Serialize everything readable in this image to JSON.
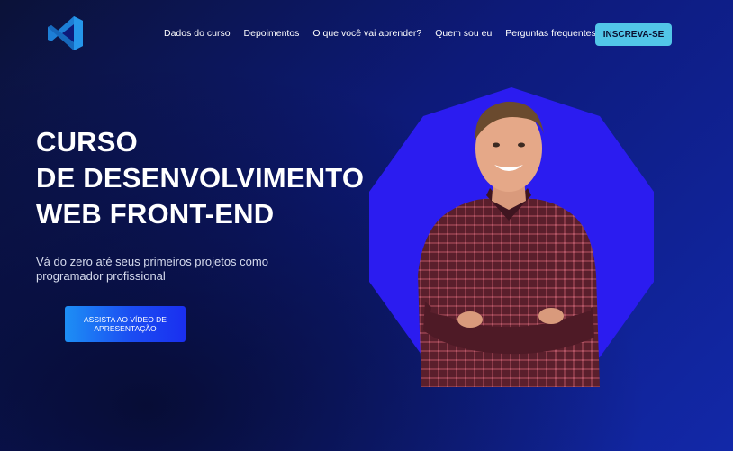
{
  "header": {
    "logo_icon": "vscode-logo-icon",
    "nav": [
      {
        "label": "Dados do curso"
      },
      {
        "label": "Depoimentos"
      },
      {
        "label": "O que você vai aprender?"
      },
      {
        "label": "Quem sou eu"
      },
      {
        "label": "Perguntas frequentes"
      }
    ],
    "cta_label": "INSCREVA-SE"
  },
  "hero": {
    "title_lines": [
      "CURSO",
      "DE DESENVOLVIMENTO",
      "WEB FRONT-END"
    ],
    "subtitle": "Vá do zero até seus primeiros projetos como programador profissional",
    "video_button_label": "ASSISTA AO VÍDEO DE APRESENTAÇÃO"
  },
  "colors": {
    "accent_cta": "#52c6e8",
    "shape_blue": "#2b1cf0",
    "background_dark": "#0b1238",
    "background_blue": "#1228a8"
  }
}
